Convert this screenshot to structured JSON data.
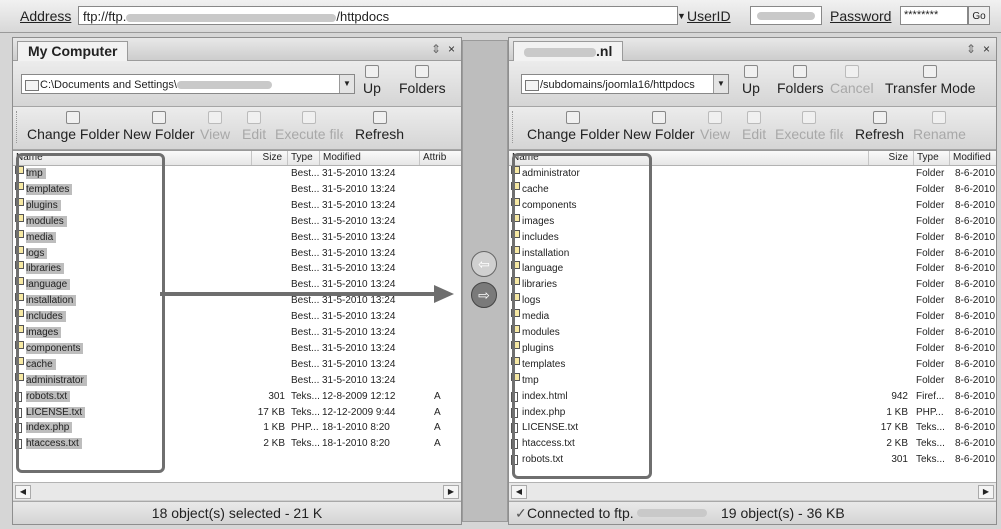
{
  "address_bar": {
    "label": "Address",
    "value_prefix": "ftp://ftp.",
    "value_suffix": "/httpdocs",
    "userid_label": "UserID",
    "password_label": "Password",
    "password_value": "********",
    "go_label": "Go"
  },
  "left_pane": {
    "title": "My Computer",
    "path": "C:\\Documents and Settings\\",
    "nav": {
      "up": "Up",
      "folders": "Folders"
    },
    "toolbar": {
      "change_folder": "Change Folder",
      "new_folder": "New Folder",
      "view": "View",
      "edit": "Edit",
      "execute": "Execute file",
      "refresh": "Refresh"
    },
    "columns": {
      "name": "Name",
      "size": "Size",
      "type": "Type",
      "modified": "Modified",
      "attrib": "Attrib"
    },
    "rows": [
      {
        "name": "tmp",
        "size": "",
        "type": "Best...",
        "modified": "31-5-2010 13:24",
        "attrib": "",
        "kind": "folder"
      },
      {
        "name": "templates",
        "size": "",
        "type": "Best...",
        "modified": "31-5-2010 13:24",
        "attrib": "",
        "kind": "folder"
      },
      {
        "name": "plugins",
        "size": "",
        "type": "Best...",
        "modified": "31-5-2010 13:24",
        "attrib": "",
        "kind": "folder"
      },
      {
        "name": "modules",
        "size": "",
        "type": "Best...",
        "modified": "31-5-2010 13:24",
        "attrib": "",
        "kind": "folder"
      },
      {
        "name": "media",
        "size": "",
        "type": "Best...",
        "modified": "31-5-2010 13:24",
        "attrib": "",
        "kind": "folder"
      },
      {
        "name": "logs",
        "size": "",
        "type": "Best...",
        "modified": "31-5-2010 13:24",
        "attrib": "",
        "kind": "folder"
      },
      {
        "name": "libraries",
        "size": "",
        "type": "Best...",
        "modified": "31-5-2010 13:24",
        "attrib": "",
        "kind": "folder"
      },
      {
        "name": "language",
        "size": "",
        "type": "Best...",
        "modified": "31-5-2010 13:24",
        "attrib": "",
        "kind": "folder"
      },
      {
        "name": "installation",
        "size": "",
        "type": "Best...",
        "modified": "31-5-2010 13:24",
        "attrib": "",
        "kind": "folder"
      },
      {
        "name": "includes",
        "size": "",
        "type": "Best...",
        "modified": "31-5-2010 13:24",
        "attrib": "",
        "kind": "folder"
      },
      {
        "name": "images",
        "size": "",
        "type": "Best...",
        "modified": "31-5-2010 13:24",
        "attrib": "",
        "kind": "folder"
      },
      {
        "name": "components",
        "size": "",
        "type": "Best...",
        "modified": "31-5-2010 13:24",
        "attrib": "",
        "kind": "folder"
      },
      {
        "name": "cache",
        "size": "",
        "type": "Best...",
        "modified": "31-5-2010 13:24",
        "attrib": "",
        "kind": "folder"
      },
      {
        "name": "administrator",
        "size": "",
        "type": "Best...",
        "modified": "31-5-2010 13:24",
        "attrib": "",
        "kind": "folder"
      },
      {
        "name": "robots.txt",
        "size": "301",
        "type": "Teks...",
        "modified": "12-8-2009 12:12",
        "attrib": "A",
        "kind": "file"
      },
      {
        "name": "LICENSE.txt",
        "size": "17 KB",
        "type": "Teks...",
        "modified": "12-12-2009 9:44",
        "attrib": "A",
        "kind": "file"
      },
      {
        "name": "index.php",
        "size": "1 KB",
        "type": "PHP...",
        "modified": "18-1-2010 8:20",
        "attrib": "A",
        "kind": "file"
      },
      {
        "name": "htaccess.txt",
        "size": "2 KB",
        "type": "Teks...",
        "modified": "18-1-2010 8:20",
        "attrib": "A",
        "kind": "file"
      }
    ],
    "status": "18 object(s) selected - 21 K"
  },
  "right_pane": {
    "title_suffix": ".nl",
    "path": "/subdomains/joomla16/httpdocs",
    "nav": {
      "up": "Up",
      "folders": "Folders",
      "cancel": "Cancel",
      "transfer_mode": "Transfer Mode"
    },
    "toolbar": {
      "change_folder": "Change Folder",
      "new_folder": "New Folder",
      "view": "View",
      "edit": "Edit",
      "execute": "Execute file",
      "refresh": "Refresh",
      "rename": "Rename"
    },
    "columns": {
      "name": "Name",
      "size": "Size",
      "type": "Type",
      "modified": "Modified"
    },
    "rows": [
      {
        "name": "administrator",
        "size": "",
        "type": "Folder",
        "modified": "8-6-2010",
        "kind": "folder"
      },
      {
        "name": "cache",
        "size": "",
        "type": "Folder",
        "modified": "8-6-2010",
        "kind": "folder"
      },
      {
        "name": "components",
        "size": "",
        "type": "Folder",
        "modified": "8-6-2010",
        "kind": "folder"
      },
      {
        "name": "images",
        "size": "",
        "type": "Folder",
        "modified": "8-6-2010",
        "kind": "folder"
      },
      {
        "name": "includes",
        "size": "",
        "type": "Folder",
        "modified": "8-6-2010",
        "kind": "folder"
      },
      {
        "name": "installation",
        "size": "",
        "type": "Folder",
        "modified": "8-6-2010",
        "kind": "folder"
      },
      {
        "name": "language",
        "size": "",
        "type": "Folder",
        "modified": "8-6-2010",
        "kind": "folder"
      },
      {
        "name": "libraries",
        "size": "",
        "type": "Folder",
        "modified": "8-6-2010",
        "kind": "folder"
      },
      {
        "name": "logs",
        "size": "",
        "type": "Folder",
        "modified": "8-6-2010",
        "kind": "folder"
      },
      {
        "name": "media",
        "size": "",
        "type": "Folder",
        "modified": "8-6-2010",
        "kind": "folder"
      },
      {
        "name": "modules",
        "size": "",
        "type": "Folder",
        "modified": "8-6-2010",
        "kind": "folder"
      },
      {
        "name": "plugins",
        "size": "",
        "type": "Folder",
        "modified": "8-6-2010",
        "kind": "folder"
      },
      {
        "name": "templates",
        "size": "",
        "type": "Folder",
        "modified": "8-6-2010",
        "kind": "folder"
      },
      {
        "name": "tmp",
        "size": "",
        "type": "Folder",
        "modified": "8-6-2010",
        "kind": "folder"
      },
      {
        "name": "index.html",
        "size": "942",
        "type": "Firef...",
        "modified": "8-6-2010",
        "kind": "file"
      },
      {
        "name": "index.php",
        "size": "1 KB",
        "type": "PHP...",
        "modified": "8-6-2010",
        "kind": "file"
      },
      {
        "name": "LICENSE.txt",
        "size": "17 KB",
        "type": "Teks...",
        "modified": "8-6-2010",
        "kind": "file"
      },
      {
        "name": "htaccess.txt",
        "size": "2 KB",
        "type": "Teks...",
        "modified": "8-6-2010",
        "kind": "file"
      },
      {
        "name": "robots.txt",
        "size": "301",
        "type": "Teks...",
        "modified": "8-6-2010",
        "kind": "file"
      }
    ],
    "status_connected": "Connected to ftp.",
    "status_count": "19 object(s) - 36 KB"
  },
  "icons": {
    "close": "×",
    "chevron_down": "▼",
    "scroll_left": "◀",
    "scroll_right": "▶",
    "transfer_left": "⇦",
    "transfer_right": "⇨",
    "check": "✓"
  }
}
